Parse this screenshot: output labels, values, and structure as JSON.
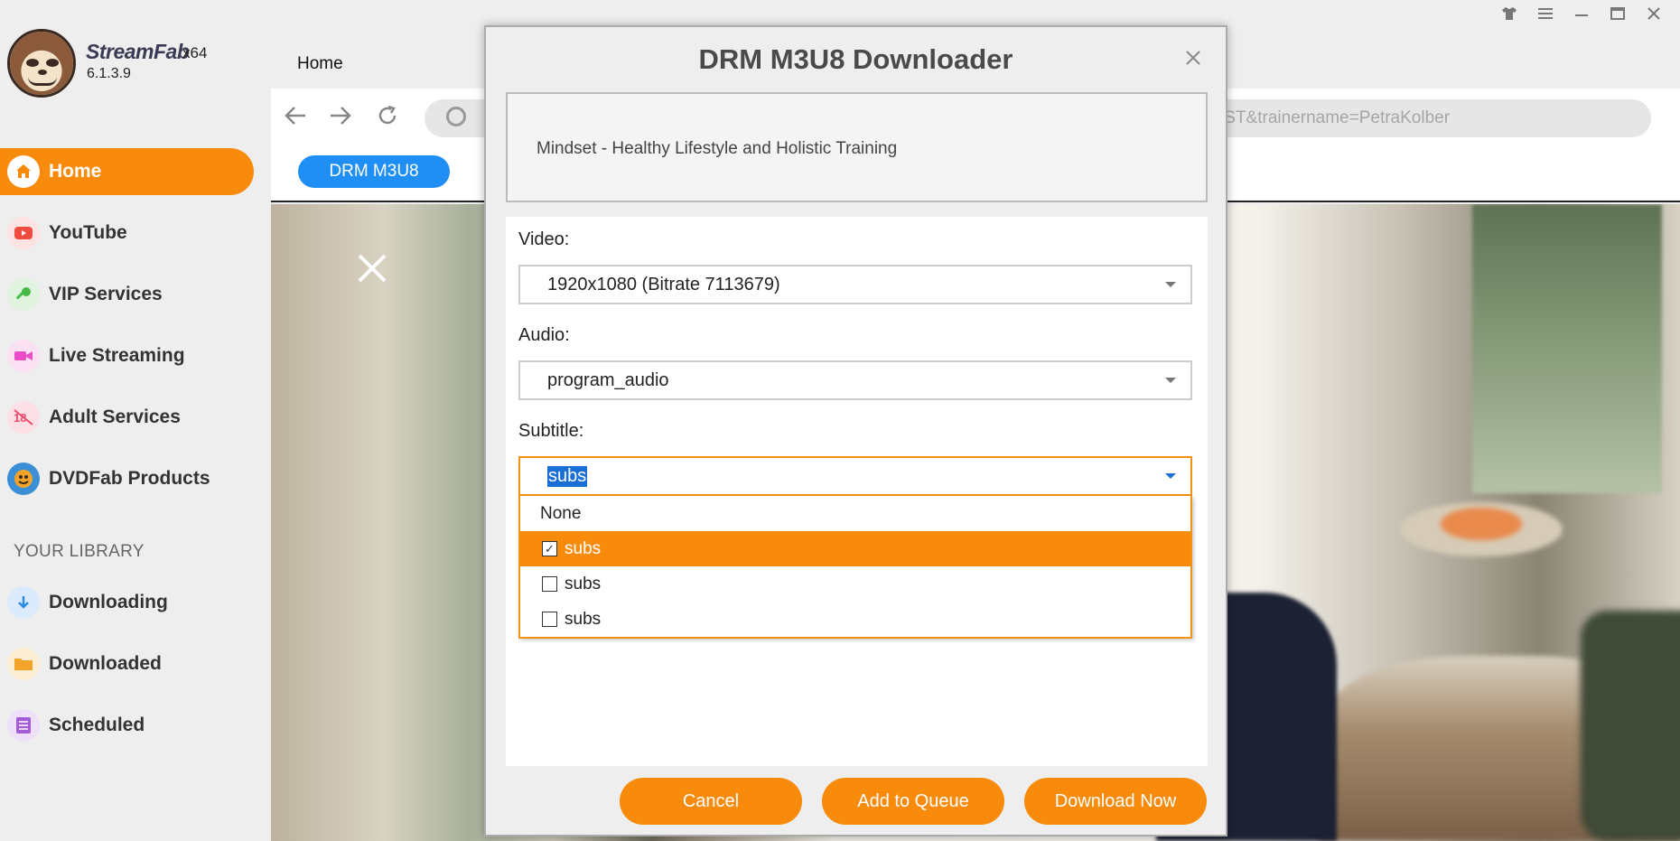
{
  "app": {
    "brand": "StreamFab",
    "arch": "x64",
    "version": "6.1.3.9"
  },
  "sidebar": {
    "items": [
      {
        "label": "Home",
        "icon": "home-icon",
        "color": "#f98b0c"
      },
      {
        "label": "YouTube",
        "icon": "youtube-icon",
        "color": "#ef4b3f"
      },
      {
        "label": "VIP Services",
        "icon": "key-icon",
        "color": "#46b94a"
      },
      {
        "label": "Live Streaming",
        "icon": "camera-icon",
        "color": "#e94cc4"
      },
      {
        "label": "Adult Services",
        "icon": "adult-icon",
        "color": "#ef4a6a"
      },
      {
        "label": "DVDFab Products",
        "icon": "dvdfab-icon",
        "color": "#3a8fd6"
      }
    ],
    "library_header": "YOUR LIBRARY",
    "library": [
      {
        "label": "Downloading",
        "icon": "download-arrow-icon",
        "color": "#2a8ce8"
      },
      {
        "label": "Downloaded",
        "icon": "folder-icon",
        "color": "#f2a42a"
      },
      {
        "label": "Scheduled",
        "icon": "list-icon",
        "color": "#a45bd6"
      }
    ]
  },
  "browser": {
    "tab_label": "Home",
    "address": "IST&trainername=PetraKolber",
    "pill": "DRM M3U8"
  },
  "dialog": {
    "title": "DRM M3U8 Downloader",
    "video_title": "Mindset - Healthy Lifestyle and Holistic Training",
    "video_label": "Video:",
    "video_value": "1920x1080 (Bitrate 7113679)",
    "audio_label": "Audio:",
    "audio_value": "program_audio",
    "subtitle_label": "Subtitle:",
    "subtitle_value": "subs",
    "subtitle_options": [
      {
        "label": "None",
        "checked": null
      },
      {
        "label": "subs",
        "checked": true
      },
      {
        "label": "subs",
        "checked": false
      },
      {
        "label": "subs",
        "checked": false
      }
    ],
    "cancel": "Cancel",
    "add_to_queue": "Add to Queue",
    "download_now": "Download Now"
  }
}
